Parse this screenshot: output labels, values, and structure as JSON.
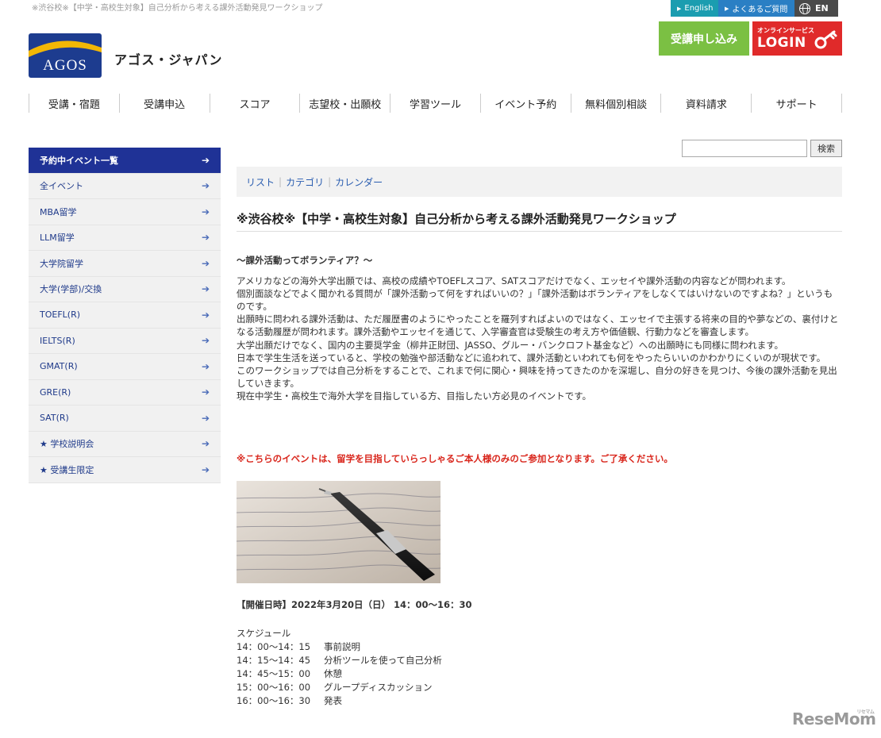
{
  "breadcrumb": "※渋谷校※【中学・高校生対象】自己分析から考える課外活動発見ワークショップ",
  "utility": {
    "english": "English",
    "faq": "よくあるご質問",
    "lang": "EN"
  },
  "logo": {
    "mark": "AGOS",
    "name": "アゴス・ジャパン"
  },
  "cta": {
    "apply": "受講申し込み",
    "login_sub": "オンラインサービス",
    "login": "LOGIN"
  },
  "gnav": [
    "受講・宿題",
    "受講申込",
    "スコア",
    "志望校・出願校",
    "学習ツール",
    "イベント予約",
    "無料個別相談",
    "資料請求",
    "サポート"
  ],
  "sidebar": {
    "items": [
      {
        "label": "予約中イベント一覧",
        "active": true
      },
      {
        "label": "全イベント"
      },
      {
        "label": "MBA留学"
      },
      {
        "label": "LLM留学"
      },
      {
        "label": "大学院留学"
      },
      {
        "label": "大学(学部)/交換"
      },
      {
        "label": "TOEFL(R)"
      },
      {
        "label": "IELTS(R)"
      },
      {
        "label": "GMAT(R)"
      },
      {
        "label": "GRE(R)"
      },
      {
        "label": "SAT(R)"
      },
      {
        "label": "★ 学校説明会"
      },
      {
        "label": "★ 受講生限定"
      }
    ],
    "arrow": "➔"
  },
  "search": {
    "placeholder": "",
    "button": "検索"
  },
  "view_tabs": {
    "list": "リスト",
    "category": "カテゴリ",
    "calendar": "カレンダー",
    "sep": "|"
  },
  "event": {
    "title": "※渋谷校※【中学・高校生対象】自己分析から考える課外活動発見ワークショップ",
    "heading": "～課外活動ってボランティア？～",
    "paragraphs": [
      "アメリカなどの海外大学出願では、高校の成績やTOEFLスコア、SATスコアだけでなく、エッセイや課外活動の内容などが問われます。",
      "個別面談などでよく聞かれる質問が「課外活動って何をすればいいの？」「課外活動はボランティアをしなくてはいけないのですよね？」というものです。",
      "出願時に問われる課外活動は、ただ履歴書のようにやったことを羅列すればよいのではなく、エッセイで主張する将来の目的や夢などの、裏付けとなる活動履歴が問われます。課外活動やエッセイを通じて、入学審査官は受験生の考え方や価値観、行動力などを審査します。",
      "大学出願だけでなく、国内の主要奨学金（柳井正財団、JASSO、グルー・バンクロフト基金など）への出願時にも同様に問われます。",
      "日本で学生生活を送っていると、学校の勉強や部活動などに追われて、課外活動といわれても何をやったらいいのかわかりにくいのが現状です。",
      "このワークショップでは自己分析をすることで、これまで何に関心・興味を持ってきたのかを深堀し、自分の好きを見つけ、今後の課外活動を見出していきます。",
      "現在中学生・高校生で海外大学を目指している方、目指したい方必見のイベントです。"
    ],
    "notice": "※こちらのイベントは、留学を目指していらっしゃるご本人様のみのご参加となります。ご了承ください。",
    "date": "【開催日時】2022年3月20日（日） 14：00～16：30",
    "schedule_title": "スケジュール",
    "schedule": [
      {
        "time": "14：00～14：15",
        "item": "事前説明"
      },
      {
        "time": "14：15～14：45",
        "item": "分析ツールを使って自己分析"
      },
      {
        "time": "14：45～15：00",
        "item": "休憩"
      },
      {
        "time": "15：00～16：00",
        "item": "グループディスカッション"
      },
      {
        "time": "16：00～16：30",
        "item": "発表"
      }
    ]
  },
  "watermark": {
    "text": "ReseMom",
    "sub": "リセマム"
  },
  "colors": {
    "nav_active": "#1f3296",
    "apply": "#7bc043",
    "login": "#e02a2a",
    "notice": "#d9261c",
    "link": "#2a5db0"
  }
}
